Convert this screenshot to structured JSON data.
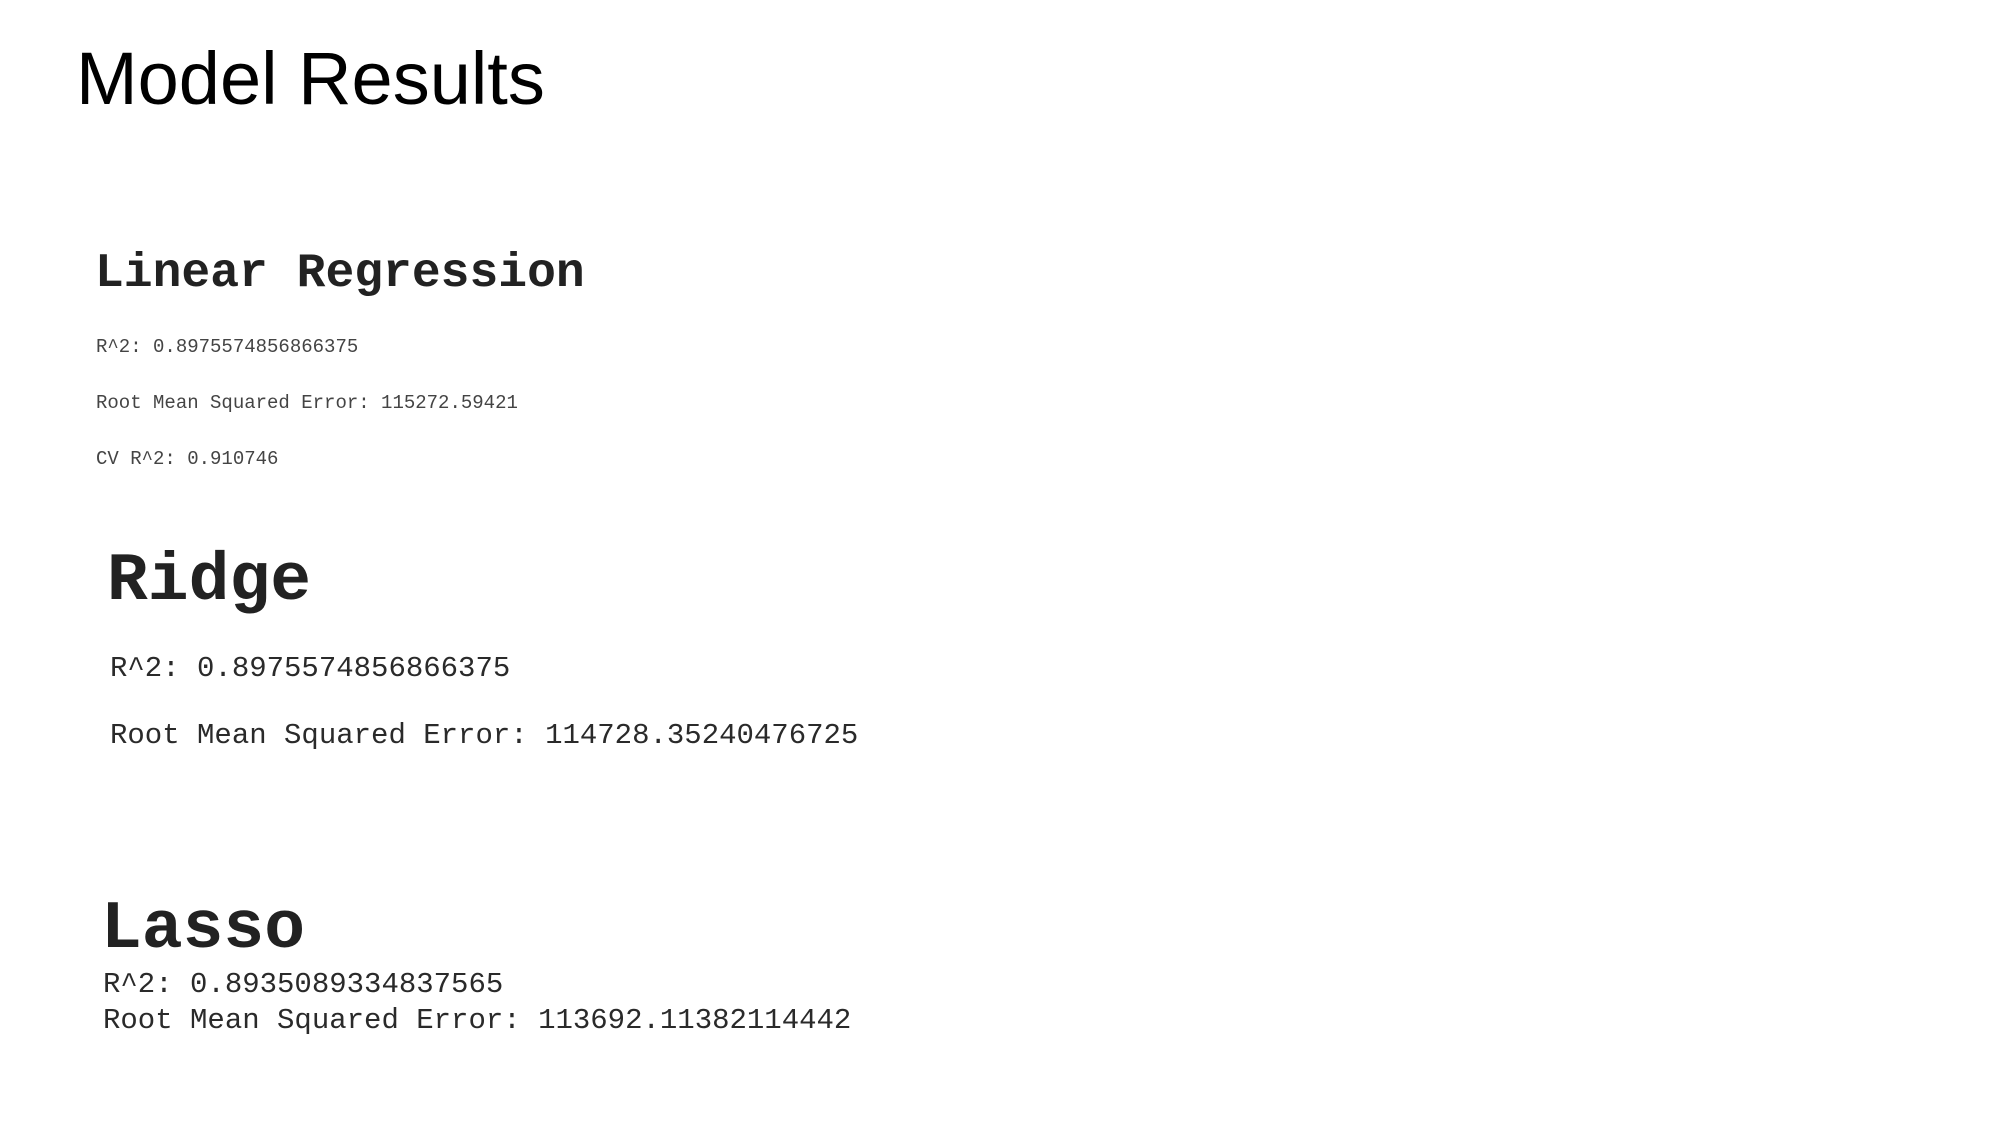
{
  "title": "Model Results",
  "models": {
    "linear_regression": {
      "heading": "Linear Regression",
      "r2": "R^2: 0.8975574856866375",
      "rmse": "Root Mean Squared Error: 115272.59421",
      "cv_r2": "CV R^2: 0.910746"
    },
    "ridge": {
      "heading": "Ridge",
      "r2": "R^2: 0.8975574856866375",
      "rmse": "Root Mean Squared Error: 114728.35240476725"
    },
    "lasso": {
      "heading": "Lasso",
      "r2": "R^2: 0.8935089334837565",
      "rmse": "Root Mean Squared Error: 113692.11382114442"
    }
  }
}
